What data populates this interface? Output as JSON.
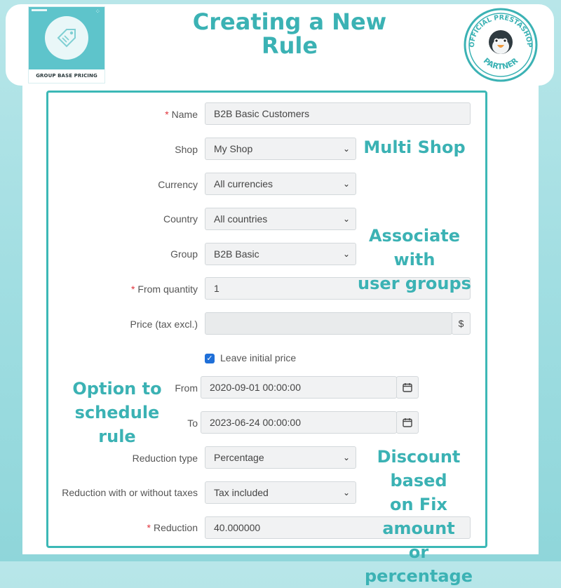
{
  "header": {
    "title_line1": "Creating a New",
    "title_line2": "Rule",
    "logo_label": "GROUP BASE PRICING",
    "logo_icon": "price-tag-icon",
    "badge_top": "OFFICIAL PRESTASHOP",
    "badge_bottom": "PARTNER",
    "badge_icon": "puffin-mascot-icon"
  },
  "form": {
    "name": {
      "label": "Name",
      "value": "B2B Basic Customers"
    },
    "shop": {
      "label": "Shop",
      "value": "My Shop"
    },
    "currency": {
      "label": "Currency",
      "value": "All currencies"
    },
    "country": {
      "label": "Country",
      "value": "All countries"
    },
    "group": {
      "label": "Group",
      "value": "B2B Basic"
    },
    "from_quantity": {
      "label": "From quantity",
      "value": "1"
    },
    "price": {
      "label": "Price (tax excl.)",
      "value": "",
      "addon": "$"
    },
    "leave_initial": {
      "label": "Leave initial price",
      "checked": true
    },
    "from": {
      "label": "From",
      "value": "2020-09-01 00:00:00"
    },
    "to": {
      "label": "To",
      "value": "2023-06-24 00:00:00"
    },
    "reduction_type": {
      "label": "Reduction type",
      "value": "Percentage"
    },
    "reduction_tax": {
      "label": "Reduction with or without taxes",
      "value": "Tax included"
    },
    "reduction": {
      "label": "Reduction",
      "value": "40.000000"
    }
  },
  "notes": {
    "multi_shop": "Multi Shop",
    "groups_line1": "Associate with",
    "groups_line2": "user groups",
    "schedule_line1": "Option to",
    "schedule_line2": "schedule rule",
    "discount_line1": "Discount based",
    "discount_line2": "on Fix amount",
    "discount_line3": "or percentage"
  },
  "colors": {
    "accent": "#3bb2b4",
    "frame": "#3cb8b6",
    "required": "#e0323a",
    "checkbox": "#1f6fd8"
  }
}
